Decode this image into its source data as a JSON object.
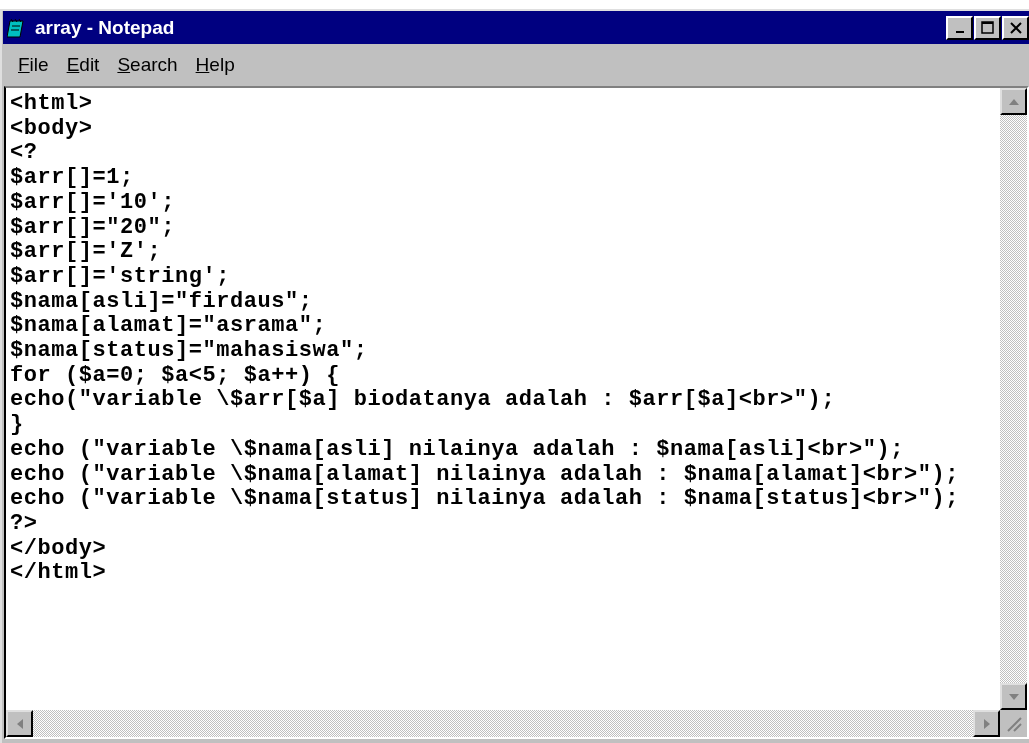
{
  "window": {
    "title": "array - Notepad"
  },
  "menu": [
    "File",
    "Edit",
    "Search",
    "Help"
  ],
  "editor": {
    "lines": [
      "<html>",
      "<body>",
      "<?",
      "$arr[]=1;",
      "$arr[]='10';",
      "$arr[]=\"20\";",
      "$arr[]='Z';",
      "$arr[]='string';",
      "$nama[asli]=\"firdaus\";",
      "$nama[alamat]=\"asrama\";",
      "$nama[status]=\"mahasiswa\";",
      "for ($a=0; $a<5; $a++) {",
      "echo(\"variable \\$arr[$a] biodatanya adalah : $arr[$a]<br>\");",
      "}",
      "echo (\"variable \\$nama[asli] nilainya adalah : $nama[asli]<br>\");",
      "echo (\"variable \\$nama[alamat] nilainya adalah : $nama[alamat]<br>\");",
      "echo (\"variable \\$nama[status] nilainya adalah : $nama[status]<br>\");",
      "?>",
      "</body>",
      "</html>"
    ]
  }
}
